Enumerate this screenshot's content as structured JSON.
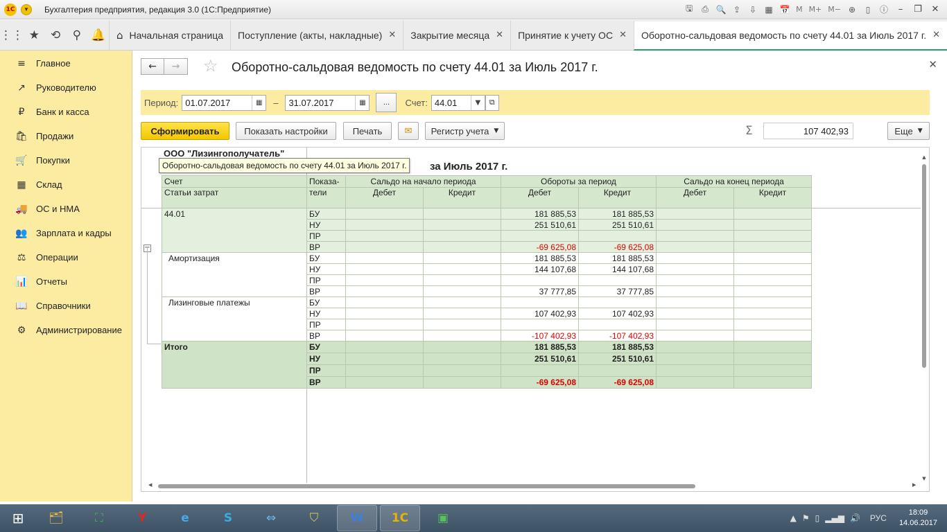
{
  "window": {
    "title": "Бухгалтерия предприятия, редакция 3.0  (1С:Предприятие)",
    "logo_text": "1С",
    "tool_m": "M",
    "tool_mplus": "M+",
    "tool_mminus": "M−"
  },
  "tabs": [
    {
      "label": "Начальная страница"
    },
    {
      "label": "Поступление (акты, накладные)"
    },
    {
      "label": "Закрытие месяца"
    },
    {
      "label": "Принятие к учету ОС"
    },
    {
      "label": "Оборотно-сальдовая ведомость по счету 44.01 за Июль 2017 г."
    }
  ],
  "sidebar": {
    "items": [
      {
        "label": "Главное",
        "icon": "≡"
      },
      {
        "label": "Руководителю",
        "icon": "↗"
      },
      {
        "label": "Банк и касса",
        "icon": "₽"
      },
      {
        "label": "Продажи",
        "icon": "🛍"
      },
      {
        "label": "Покупки",
        "icon": "🛒"
      },
      {
        "label": "Склад",
        "icon": "▦"
      },
      {
        "label": "ОС и НМА",
        "icon": "🚚"
      },
      {
        "label": "Зарплата и кадры",
        "icon": "👥"
      },
      {
        "label": "Операции",
        "icon": "⚖"
      },
      {
        "label": "Отчеты",
        "icon": "📊"
      },
      {
        "label": "Справочники",
        "icon": "📖"
      },
      {
        "label": "Администрирование",
        "icon": "⚙"
      }
    ]
  },
  "doc": {
    "title": "Оборотно-сальдовая ведомость по счету 44.01 за Июль 2017 г."
  },
  "params": {
    "period_label": "Период:",
    "date_from": "01.07.2017",
    "dash": "–",
    "date_to": "31.07.2017",
    "dots": "...",
    "account_label": "Счет:",
    "account": "44.01"
  },
  "toolbar": {
    "generate": "Сформировать",
    "show_settings": "Показать настройки",
    "print": "Печать",
    "register": "Регистр учета",
    "sum": "107 402,93",
    "more": "Еще"
  },
  "report": {
    "org": "ООО \"Лизингополучатель\"",
    "title_visible": "за Июль 2017 г.",
    "tooltip": "Оборотно-сальдовая ведомость по счету 44.01 за Июль 2017 г.",
    "headers": {
      "account": "Счет",
      "cost_items": "Статьи затрат",
      "indicators_1": "Показа-",
      "indicators_2": "тели",
      "opening": "Сальдо на начало периода",
      "turnover": "Обороты за период",
      "closing": "Сальдо на конец периода",
      "debit": "Дебет",
      "credit": "Кредит"
    },
    "groups": [
      {
        "label": "44.01",
        "style": "g",
        "rows": [
          {
            "ind": "БУ",
            "od": "",
            "oc": "",
            "td": "181 885,53",
            "tc": "181 885,53",
            "cd": "",
            "cc": ""
          },
          {
            "ind": "НУ",
            "od": "",
            "oc": "",
            "td": "251 510,61",
            "tc": "251 510,61",
            "cd": "",
            "cc": ""
          },
          {
            "ind": "ПР",
            "od": "",
            "oc": "",
            "td": "",
            "tc": "",
            "cd": "",
            "cc": ""
          },
          {
            "ind": "ВР",
            "od": "",
            "oc": "",
            "td": "-69 625,08",
            "tc": "-69 625,08",
            "cd": "",
            "cc": ""
          }
        ]
      },
      {
        "label": "Амортизация",
        "style": "w",
        "rows": [
          {
            "ind": "БУ",
            "od": "",
            "oc": "",
            "td": "181 885,53",
            "tc": "181 885,53",
            "cd": "",
            "cc": ""
          },
          {
            "ind": "НУ",
            "od": "",
            "oc": "",
            "td": "144 107,68",
            "tc": "144 107,68",
            "cd": "",
            "cc": ""
          },
          {
            "ind": "ПР",
            "od": "",
            "oc": "",
            "td": "",
            "tc": "",
            "cd": "",
            "cc": ""
          },
          {
            "ind": "ВР",
            "od": "",
            "oc": "",
            "td": "37 777,85",
            "tc": "37 777,85",
            "cd": "",
            "cc": ""
          }
        ]
      },
      {
        "label": "Лизинговые платежы",
        "style": "w",
        "rows": [
          {
            "ind": "БУ",
            "od": "",
            "oc": "",
            "td": "",
            "tc": "",
            "cd": "",
            "cc": ""
          },
          {
            "ind": "НУ",
            "od": "",
            "oc": "",
            "td": "107 402,93",
            "tc": "107 402,93",
            "cd": "",
            "cc": ""
          },
          {
            "ind": "ПР",
            "od": "",
            "oc": "",
            "td": "",
            "tc": "",
            "cd": "",
            "cc": ""
          },
          {
            "ind": "ВР",
            "od": "",
            "oc": "",
            "td": "-107 402,93",
            "tc": "-107 402,93",
            "cd": "",
            "cc": ""
          }
        ]
      },
      {
        "label": "Итого",
        "style": "t",
        "rows": [
          {
            "ind": "БУ",
            "od": "",
            "oc": "",
            "td": "181 885,53",
            "tc": "181 885,53",
            "cd": "",
            "cc": ""
          },
          {
            "ind": "НУ",
            "od": "",
            "oc": "",
            "td": "251 510,61",
            "tc": "251 510,61",
            "cd": "",
            "cc": ""
          },
          {
            "ind": "ПР",
            "od": "",
            "oc": "",
            "td": "",
            "tc": "",
            "cd": "",
            "cc": ""
          },
          {
            "ind": "ВР",
            "od": "",
            "oc": "",
            "td": "-69 625,08",
            "tc": "-69 625,08",
            "cd": "",
            "cc": ""
          }
        ]
      }
    ]
  },
  "taskbar": {
    "lang": "РУС",
    "time": "18:09",
    "date": "14.06.2017"
  }
}
